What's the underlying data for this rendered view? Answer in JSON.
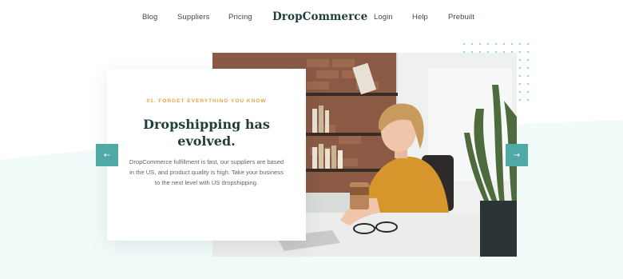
{
  "nav": {
    "left_links": [
      "Blog",
      "Suppliers",
      "Pricing"
    ],
    "brand": "DropCommerce",
    "right_links": [
      "Login",
      "Help",
      "Prebuilt"
    ]
  },
  "hero": {
    "eyebrow": "01. FORGET EVERYTHING YOU KNOW",
    "headline": "Dropshipping has evolved.",
    "body": "DropCommerce fulfillment is fast, our suppliers are based in the US, and product quality is high. Take your business to the next level with US dropshipping.",
    "prev_arrow": "←",
    "next_arrow": "→"
  },
  "colors": {
    "accent": "#4fa9a4",
    "eyebrow": "#e3a44a",
    "heading": "#1f3d3a",
    "wave": "#f1fbfa",
    "dots": "#7fd3d0"
  },
  "icons": [
    "arrow-left-icon",
    "arrow-right-icon"
  ]
}
